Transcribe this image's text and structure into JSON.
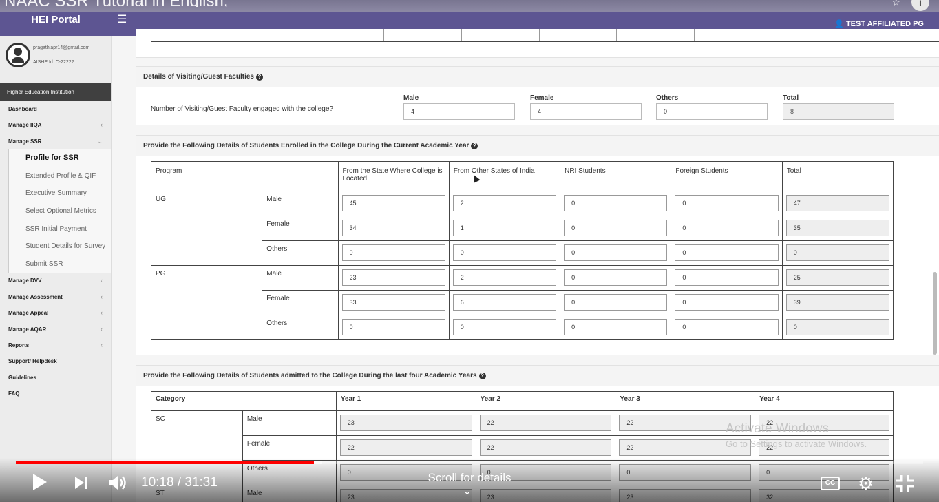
{
  "video": {
    "title": "NAAC SSR Tutorial in English,",
    "time": "10:18 / 31:31",
    "progress_fraction": 0.3283,
    "scroll_hint": "Scroll for details",
    "watermark_title": "Activate Windows",
    "watermark_sub": "Go to Settings to activate Windows."
  },
  "topbar": {
    "brand": "HEI Portal",
    "user": "TEST AFFILIATED PG",
    "color": "#5d5592"
  },
  "profile": {
    "email": "pragathiapr14@gmail.com",
    "aishe": "AISHE Id: C-22222"
  },
  "sidebar": {
    "header": "Higher Education Institution",
    "items": [
      {
        "label": "Dashboard",
        "chev": ""
      },
      {
        "label": "Manage IIQA",
        "chev": "‹"
      },
      {
        "label": "Manage SSR",
        "chev": "⌄"
      }
    ],
    "subitems": [
      {
        "label": "Profile for SSR",
        "active": true
      },
      {
        "label": "Extended Profile & QIF"
      },
      {
        "label": "Executive Summary"
      },
      {
        "label": "Select Optional Metrics"
      },
      {
        "label": "SSR Initial Payment"
      },
      {
        "label": "Student Details for Survey"
      },
      {
        "label": "Submit SSR"
      }
    ],
    "items2": [
      {
        "label": "Manage DVV",
        "chev": "‹"
      },
      {
        "label": "Manage Assessment",
        "chev": "‹"
      },
      {
        "label": "Manage Appeal",
        "chev": "‹"
      },
      {
        "label": "Manage AQAR",
        "chev": "‹"
      },
      {
        "label": "Reports",
        "chev": "‹"
      },
      {
        "label": "Support/ Helpdesk",
        "chev": ""
      },
      {
        "label": "Guidelines",
        "chev": ""
      },
      {
        "label": "FAQ",
        "chev": ""
      }
    ]
  },
  "visiting": {
    "heading": "Details of Visiting/Guest Faculties",
    "question": "Number of Visiting/Guest Faculty engaged with the college?",
    "male_label": "Male",
    "male": "4",
    "female_label": "Female",
    "female": "4",
    "others_label": "Others",
    "others": "0",
    "total_label": "Total",
    "total": "8"
  },
  "enrolled": {
    "heading": "Provide the Following Details of Students Enrolled in the College During the Current Academic Year",
    "headers": [
      "Program",
      "From the State Where College is Located",
      "From Other States of India",
      "NRI Students",
      "Foreign Students",
      "Total"
    ],
    "rows": [
      {
        "program": "UG",
        "gender": "Male",
        "values": [
          "45",
          "2",
          "0",
          "0",
          "47"
        ]
      },
      {
        "program": "",
        "gender": "Female",
        "values": [
          "34",
          "1",
          "0",
          "0",
          "35"
        ]
      },
      {
        "program": "",
        "gender": "Others",
        "values": [
          "0",
          "0",
          "0",
          "0",
          "0"
        ]
      },
      {
        "program": "PG",
        "gender": "Male",
        "values": [
          "23",
          "2",
          "0",
          "0",
          "25"
        ]
      },
      {
        "program": "",
        "gender": "Female",
        "values": [
          "33",
          "6",
          "0",
          "0",
          "39"
        ]
      },
      {
        "program": "",
        "gender": "Others",
        "values": [
          "0",
          "0",
          "0",
          "0",
          "0"
        ]
      }
    ]
  },
  "admitted": {
    "heading": "Provide the Following Details of Students admitted to the College During the last four Academic Years",
    "headers": [
      "Category",
      "Year 1",
      "Year 2",
      "Year 3",
      "Year 4"
    ],
    "rows": [
      {
        "category": "SC",
        "gender": "Male",
        "values": [
          "23",
          "22",
          "22",
          "22"
        ]
      },
      {
        "category": "",
        "gender": "Female",
        "values": [
          "22",
          "22",
          "22",
          "22"
        ]
      },
      {
        "category": "",
        "gender": "Others",
        "values": [
          "0",
          "0",
          "0",
          "0"
        ]
      },
      {
        "category": "ST",
        "gender": "Male",
        "values": [
          "23",
          "23",
          "23",
          "32"
        ]
      }
    ]
  }
}
